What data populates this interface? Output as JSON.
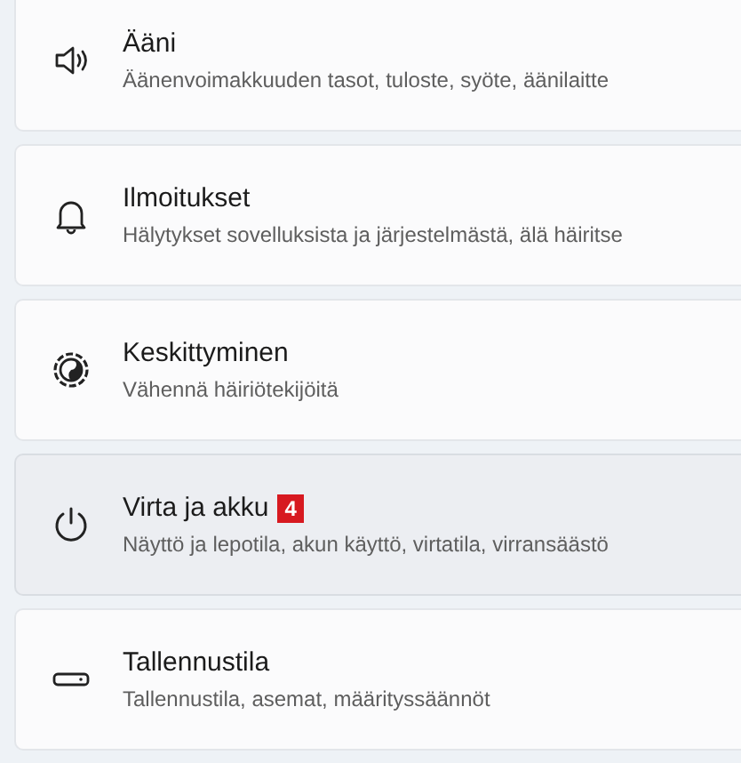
{
  "settings_items": [
    {
      "title": "Ääni",
      "description": "Äänenvoimakkuuden tasot, tuloste, syöte, äänilaitte",
      "hovered": false
    },
    {
      "title": "Ilmoitukset",
      "description": "Hälytykset sovelluksista ja järjestelmästä, älä häiritse",
      "hovered": false
    },
    {
      "title": "Keskittyminen",
      "description": "Vähennä häiriötekijöitä",
      "hovered": false
    },
    {
      "title": "Virta ja akku",
      "badge": "4",
      "description": "Näyttö ja lepotila, akun käyttö, virtatila, virransäästö",
      "hovered": true
    },
    {
      "title": "Tallennustila",
      "description": "Tallennustila, asemat, määrityssäännöt",
      "hovered": false
    }
  ]
}
